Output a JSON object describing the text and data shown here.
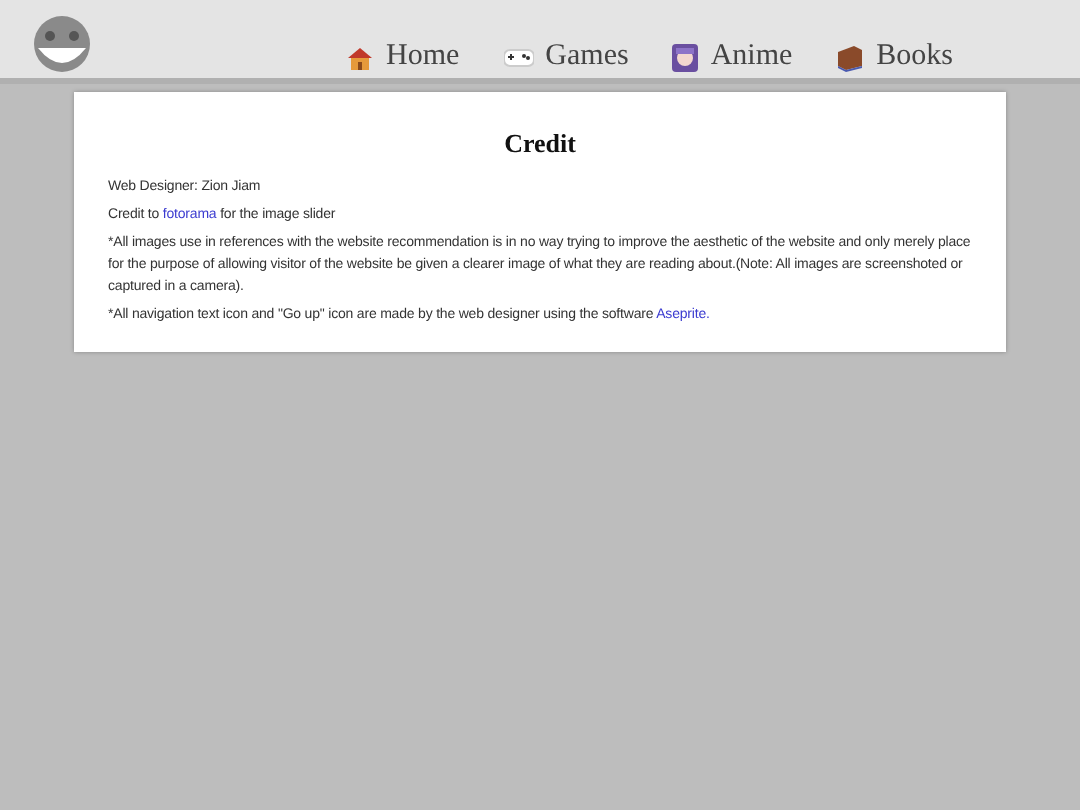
{
  "nav": [
    {
      "label": "Home",
      "kind": "house"
    },
    {
      "label": "Games",
      "kind": "gamepad"
    },
    {
      "label": "Anime",
      "kind": "girl"
    },
    {
      "label": "Books",
      "kind": "book"
    }
  ],
  "card": {
    "title": "Credit",
    "paragraphs": [
      [
        {
          "text": "Web Designer: Zion Jiam"
        }
      ],
      [
        {
          "text": "Credit to "
        },
        {
          "text": "fotorama",
          "link": true
        },
        {
          "text": " for the image slider"
        }
      ],
      [
        {
          "text": "*All images use in references with the website recommendation is in no way trying to improve the aesthetic of the website and only merely place for the purpose of allowing visitor of the website be given a clearer image of what they are reading about.(Note: All images are screenshoted or captured in a camera)."
        }
      ],
      [
        {
          "text": "*All navigation text icon and \"Go up\" icon are made by the web designer using the software "
        },
        {
          "text": "Aseprite.",
          "link": true
        }
      ]
    ]
  }
}
